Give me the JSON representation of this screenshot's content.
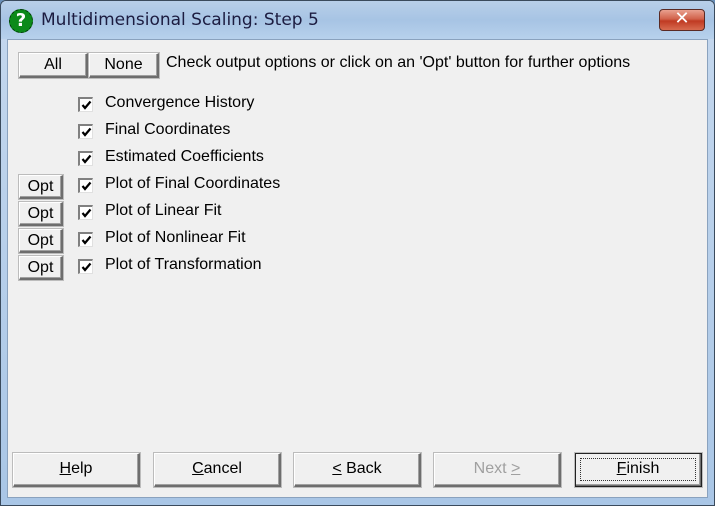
{
  "window": {
    "title": "Multidimensional Scaling: Step 5",
    "icon": "help-question-icon",
    "close_label": "✕"
  },
  "toolbar": {
    "all_label": "All",
    "none_label": "None",
    "hint": "Check output options or click on an 'Opt' button for further options"
  },
  "options": [
    {
      "label": "Convergence History",
      "checked": true,
      "has_opt": false
    },
    {
      "label": "Final Coordinates",
      "checked": true,
      "has_opt": false
    },
    {
      "label": "Estimated Coefficients",
      "checked": true,
      "has_opt": false
    },
    {
      "label": "Plot of Final Coordinates",
      "checked": true,
      "has_opt": true
    },
    {
      "label": "Plot of Linear Fit",
      "checked": true,
      "has_opt": true
    },
    {
      "label": "Plot of Nonlinear Fit",
      "checked": true,
      "has_opt": true
    },
    {
      "label": "Plot of Transformation",
      "checked": true,
      "has_opt": true
    }
  ],
  "opt_label": "Opt",
  "footer": {
    "help": {
      "mnemonic": "H",
      "rest": "elp"
    },
    "cancel": {
      "mnemonic": "C",
      "rest": "ancel"
    },
    "back": {
      "mnemonic": "<",
      "rest": " Back"
    },
    "next": {
      "pre": "Next ",
      "mnemonic": ">",
      "disabled": true
    },
    "finish": {
      "mnemonic": "F",
      "rest": "inish",
      "default": true
    }
  }
}
